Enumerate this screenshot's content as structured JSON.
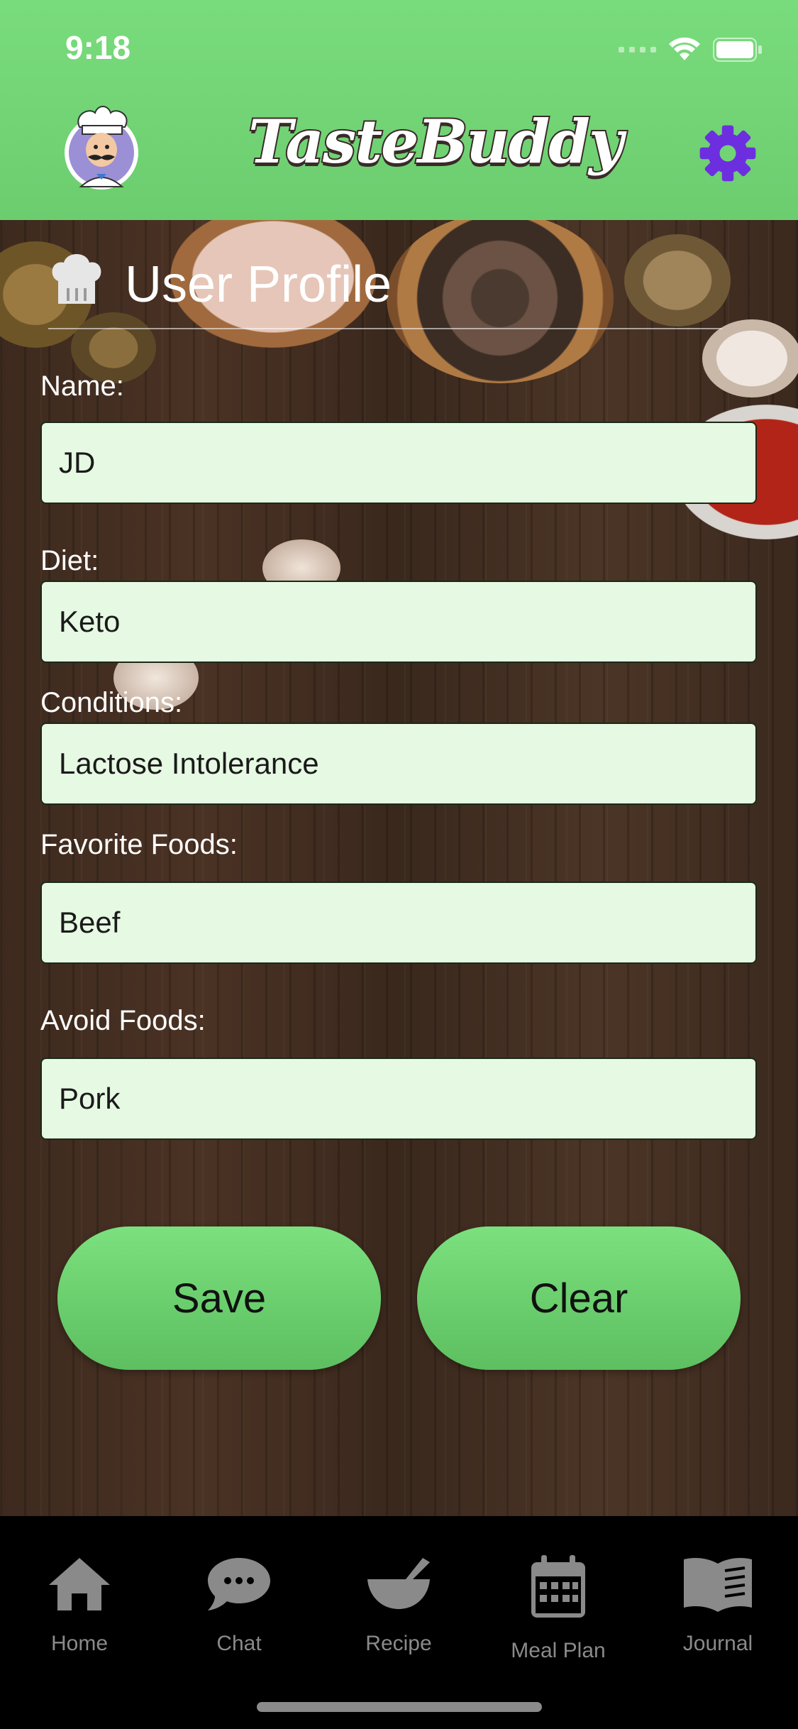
{
  "status_bar": {
    "time": "9:18"
  },
  "header": {
    "app_name": "TasteBuddy",
    "avatar_icon": "chef-avatar-icon",
    "settings_icon": "gear-icon",
    "accent": "#6d2ee0"
  },
  "profile": {
    "title": "User Profile",
    "fields": [
      {
        "label": "Name:",
        "value": "JD"
      },
      {
        "label": "Diet:",
        "value": "Keto"
      },
      {
        "label": "Conditions:",
        "value": "Lactose Intolerance"
      },
      {
        "label": "Favorite Foods:",
        "value": "Beef"
      },
      {
        "label": "Avoid Foods:",
        "value": "Pork"
      }
    ]
  },
  "actions": {
    "save_label": "Save",
    "clear_label": "Clear"
  },
  "tabs": [
    {
      "label": "Home",
      "icon": "home-icon"
    },
    {
      "label": "Chat",
      "icon": "chat-icon"
    },
    {
      "label": "Recipe",
      "icon": "mortar-pestle-icon"
    },
    {
      "label": "Meal Plan",
      "icon": "calendar-icon"
    },
    {
      "label": "Journal",
      "icon": "book-icon"
    }
  ]
}
